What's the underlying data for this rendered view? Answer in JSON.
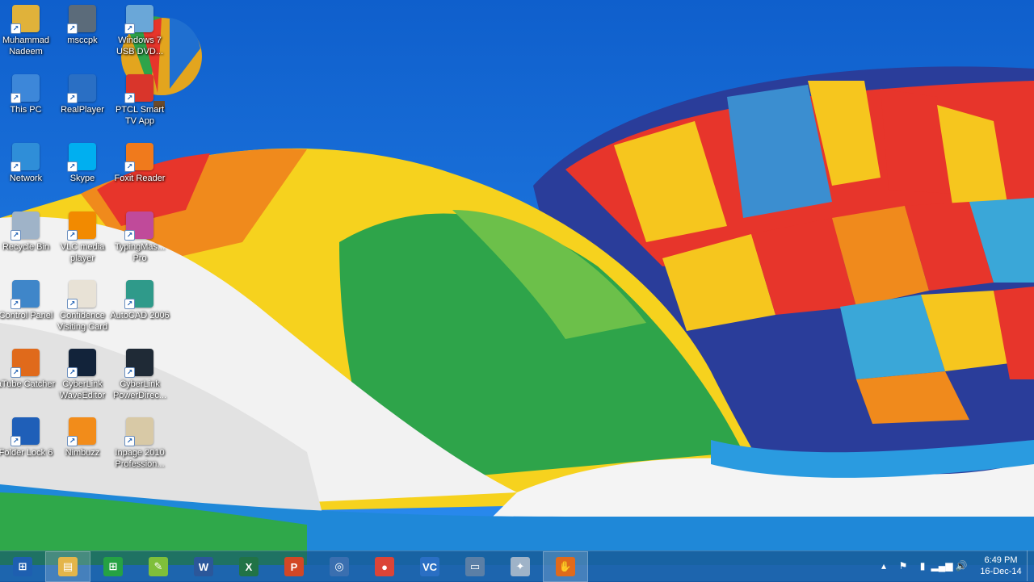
{
  "desktop": {
    "icons": [
      {
        "label": "Muhammad Nadeem",
        "icon": "user-folder-icon",
        "color": "#e0b23a"
      },
      {
        "label": "msccpk",
        "icon": "webcam-icon",
        "color": "#5b6b7a"
      },
      {
        "label": "Windows 7 USB DVD...",
        "icon": "usb-dvd-tool-icon",
        "color": "#6aa7d8"
      },
      {
        "label": "This PC",
        "icon": "computer-icon",
        "color": "#3d87d9"
      },
      {
        "label": "RealPlayer",
        "icon": "realplayer-icon",
        "color": "#2a6fc4"
      },
      {
        "label": "PTCL Smart TV App",
        "icon": "ptcl-tv-icon",
        "color": "#d9352b"
      },
      {
        "label": "Network",
        "icon": "network-globe-icon",
        "color": "#2f8ed8"
      },
      {
        "label": "Skype",
        "icon": "skype-icon",
        "color": "#00aff0"
      },
      {
        "label": "Foxit Reader",
        "icon": "foxit-reader-icon",
        "color": "#f07a1c"
      },
      {
        "label": "Recycle Bin",
        "icon": "recycle-bin-icon",
        "color": "#9fb3c8"
      },
      {
        "label": "VLC media player",
        "icon": "vlc-cone-icon",
        "color": "#f28a00"
      },
      {
        "label": "TypingMas... Pro",
        "icon": "typingmaster-icon",
        "color": "#c04a9a"
      },
      {
        "label": "Control Panel",
        "icon": "control-panel-icon",
        "color": "#3f86c9"
      },
      {
        "label": "Confidence Visiting Card",
        "icon": "visiting-card-icon",
        "color": "#e8e2d6"
      },
      {
        "label": "AutoCAD 2006",
        "icon": "autocad-icon",
        "color": "#2f9a8a"
      },
      {
        "label": "aTube Catcher",
        "icon": "atube-catcher-icon",
        "color": "#e06a1b"
      },
      {
        "label": "CyberLink WaveEditor",
        "icon": "wave-editor-icon",
        "color": "#12233a"
      },
      {
        "label": "CyberLink PowerDirec...",
        "icon": "power-director-icon",
        "color": "#1f2a36"
      },
      {
        "label": "Folder Lock 6",
        "icon": "folder-lock-icon",
        "color": "#1f5fb8"
      },
      {
        "label": "Nimbuzz",
        "icon": "nimbuzz-icon",
        "color": "#f28c1a"
      },
      {
        "label": "Inpage 2010 Profession...",
        "icon": "inpage-icon",
        "color": "#d8c9a6"
      }
    ]
  },
  "taskbar": {
    "items": [
      {
        "name": "start-button",
        "glyph": "⊞",
        "color": "#1e5fb0",
        "active": false
      },
      {
        "name": "file-explorer-button",
        "glyph": "▤",
        "color": "#e4b54a",
        "active": true
      },
      {
        "name": "store-button",
        "glyph": "⊞",
        "color": "#25a244",
        "active": false
      },
      {
        "name": "app-green-button",
        "glyph": "✎",
        "color": "#7fbf3a",
        "active": false
      },
      {
        "name": "word-button",
        "glyph": "W",
        "color": "#2b579a",
        "active": false
      },
      {
        "name": "excel-button",
        "glyph": "X",
        "color": "#217346",
        "active": false
      },
      {
        "name": "powerpoint-button",
        "glyph": "P",
        "color": "#d24726",
        "active": false
      },
      {
        "name": "media-app-button",
        "glyph": "◎",
        "color": "#3a6fb0",
        "active": false
      },
      {
        "name": "chrome-button",
        "glyph": "●",
        "color": "#db4437",
        "active": false
      },
      {
        "name": "vc-app-button",
        "glyph": "VC",
        "color": "#2a6fc4",
        "active": false
      },
      {
        "name": "presentation-app-button",
        "glyph": "▭",
        "color": "#5b7fa6",
        "active": false
      },
      {
        "name": "tool-app-button",
        "glyph": "✦",
        "color": "#9fb3c8",
        "active": false
      },
      {
        "name": "atube-catcher-taskbar-button",
        "glyph": "✋",
        "color": "#e06a1b",
        "active": true
      }
    ]
  },
  "tray": {
    "icons": [
      "chevron-up-icon",
      "flag-icon",
      "battery-icon",
      "signal-icon",
      "speaker-icon"
    ],
    "glyphs": [
      "▴",
      "⚑",
      "▮",
      "▂▄▆",
      "🔊"
    ],
    "time": "6:49 PM",
    "date": "16-Dec-14"
  }
}
